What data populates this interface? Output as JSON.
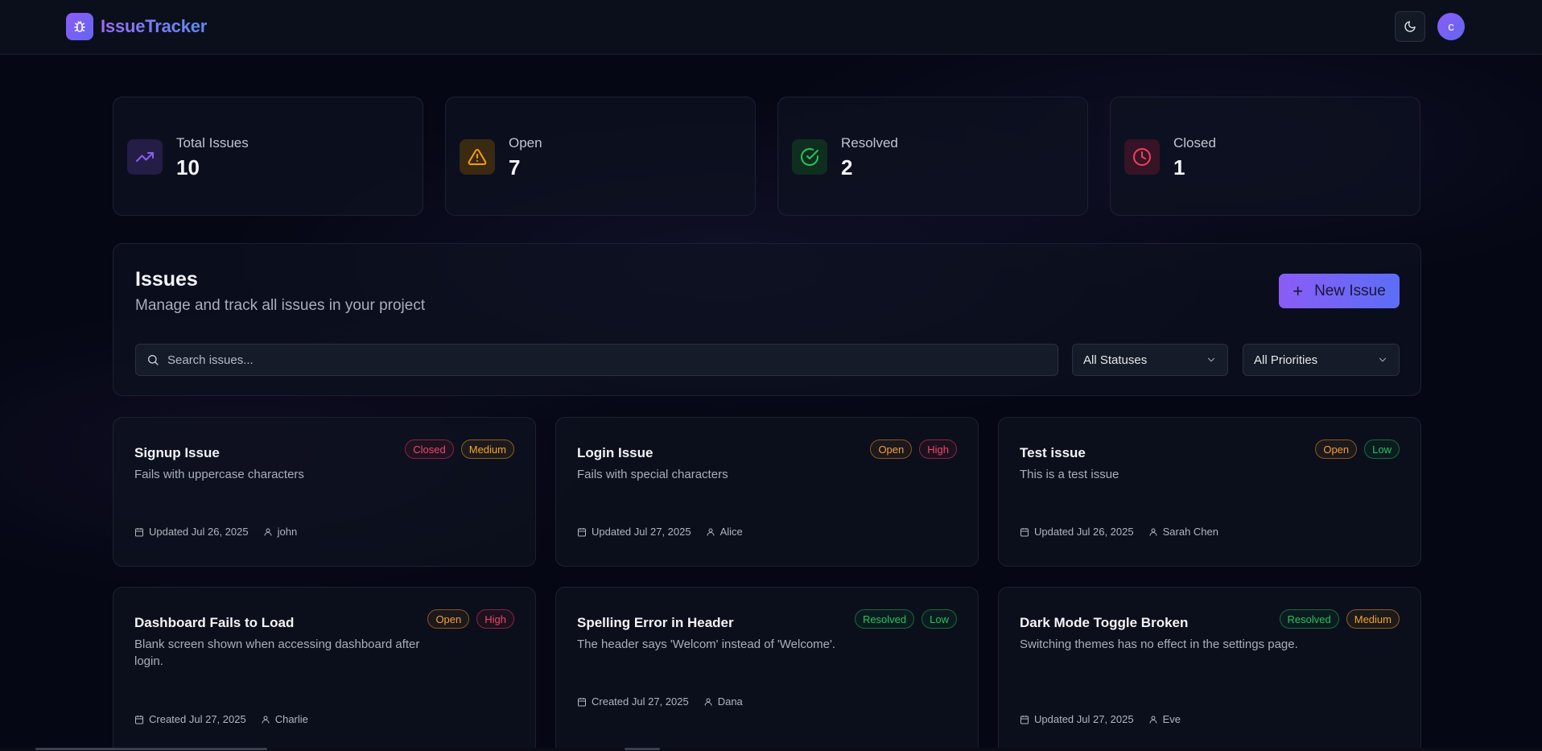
{
  "app": {
    "title": "IssueTracker",
    "avatar_letter": "c",
    "accent": "#8b5cf6"
  },
  "stats": [
    {
      "label": "Total Issues",
      "value": "10",
      "icon": "trending-up-icon",
      "color": "#8b5cf6"
    },
    {
      "label": "Open",
      "value": "7",
      "icon": "alert-triangle-icon",
      "color": "#f59e0b"
    },
    {
      "label": "Resolved",
      "value": "2",
      "icon": "check-circle-icon",
      "color": "#22c55e"
    },
    {
      "label": "Closed",
      "value": "1",
      "icon": "clock-icon",
      "color": "#f43f5e"
    }
  ],
  "issues_panel": {
    "title": "Issues",
    "subtitle": "Manage and track all issues in your project",
    "new_button": "New Issue",
    "search_placeholder": "Search issues...",
    "status_filter": "All Statuses",
    "priority_filter": "All Priorities"
  },
  "issues": [
    {
      "title": "Signup Issue",
      "description": "Fails with uppercase characters",
      "status": "Closed",
      "priority": "Medium",
      "date": "Updated Jul 26, 2025",
      "user": "john"
    },
    {
      "title": "Login Issue",
      "description": "Fails with special characters",
      "status": "Open",
      "priority": "High",
      "date": "Updated Jul 27, 2025",
      "user": "Alice"
    },
    {
      "title": "Test issue",
      "description": "This is a test issue",
      "status": "Open",
      "priority": "Low",
      "date": "Updated Jul 26, 2025",
      "user": "Sarah Chen"
    },
    {
      "title": "Dashboard Fails to Load",
      "description": "Blank screen shown when accessing dashboard after login.",
      "status": "Open",
      "priority": "High",
      "date": "Created Jul 27, 2025",
      "user": "Charlie"
    },
    {
      "title": "Spelling Error in Header",
      "description": "The header says 'Welcom' instead of 'Welcome'.",
      "status": "Resolved",
      "priority": "Low",
      "date": "Created Jul 27, 2025",
      "user": "Dana"
    },
    {
      "title": "Dark Mode Toggle Broken",
      "description": "Switching themes has no effect in the settings page.",
      "status": "Resolved",
      "priority": "Medium",
      "date": "Updated Jul 27, 2025",
      "user": "Eve"
    }
  ]
}
